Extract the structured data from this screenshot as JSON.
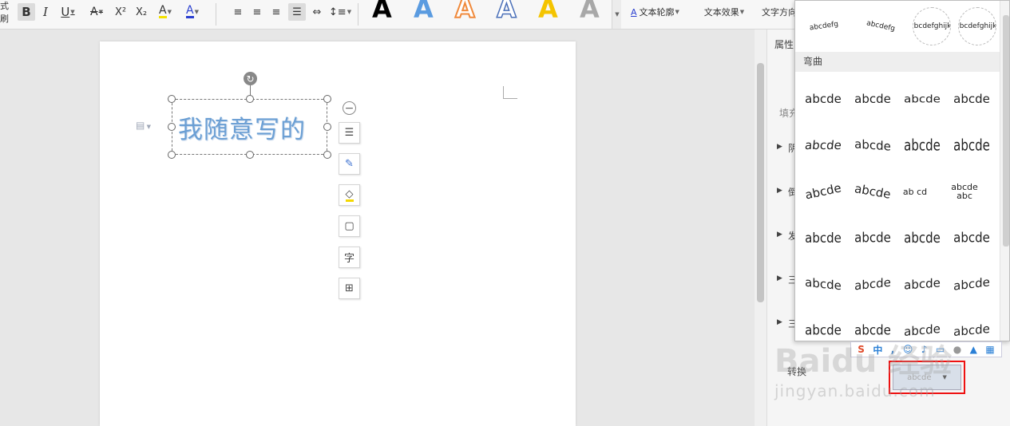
{
  "toolbar": {
    "format_painter_label": "式刷",
    "bold_label": "B",
    "italic_label": "I",
    "underline_label": "U",
    "strikethrough_label": "A",
    "superscript_label": "X²",
    "subscript_label": "X₂",
    "highlight_label": "A",
    "font_color_label": "A",
    "wordart_glyph": "A",
    "text_outline_label": "文本轮廓",
    "text_effect_label": "文本效果",
    "text_direction_label": "文字方向"
  },
  "document": {
    "textbox_text": "我随意写的"
  },
  "gallery": {
    "top_samples": [
      "abcdefg",
      "abcdefg",
      "abcdefghijkl",
      "abcdefghijkl"
    ],
    "section_label": "弯曲",
    "rows": [
      [
        "abcde",
        "abcde",
        "abcde",
        "abcde"
      ],
      [
        "abcde",
        "abcde",
        "abcde",
        "abcde"
      ],
      [
        "abcde",
        "abcde",
        "ab cd",
        "abcde abc"
      ],
      [
        "abcde",
        "abcde",
        "abcde",
        "abcde"
      ],
      [
        "abcde",
        "abcde",
        "abcde",
        "abcde"
      ],
      [
        "abcde",
        "abcde",
        "abcde",
        "abcde"
      ]
    ]
  },
  "properties_pane": {
    "title": "属性",
    "fill_label": "填充",
    "sections": [
      "阴",
      "倒",
      "发",
      "三",
      "三"
    ],
    "transform_label": "转换",
    "transform_value": "abcde"
  },
  "ime": {
    "lang_label": "中"
  },
  "watermark": {
    "brand": "Baidu 经验",
    "url": "jingyan.baidu.com"
  },
  "colors": {
    "wordart_blue": "#6b9fd4",
    "wordart_orange": "#f08a3c",
    "wordart_yellow": "#f4c400",
    "highlight_red": "#e11111"
  }
}
